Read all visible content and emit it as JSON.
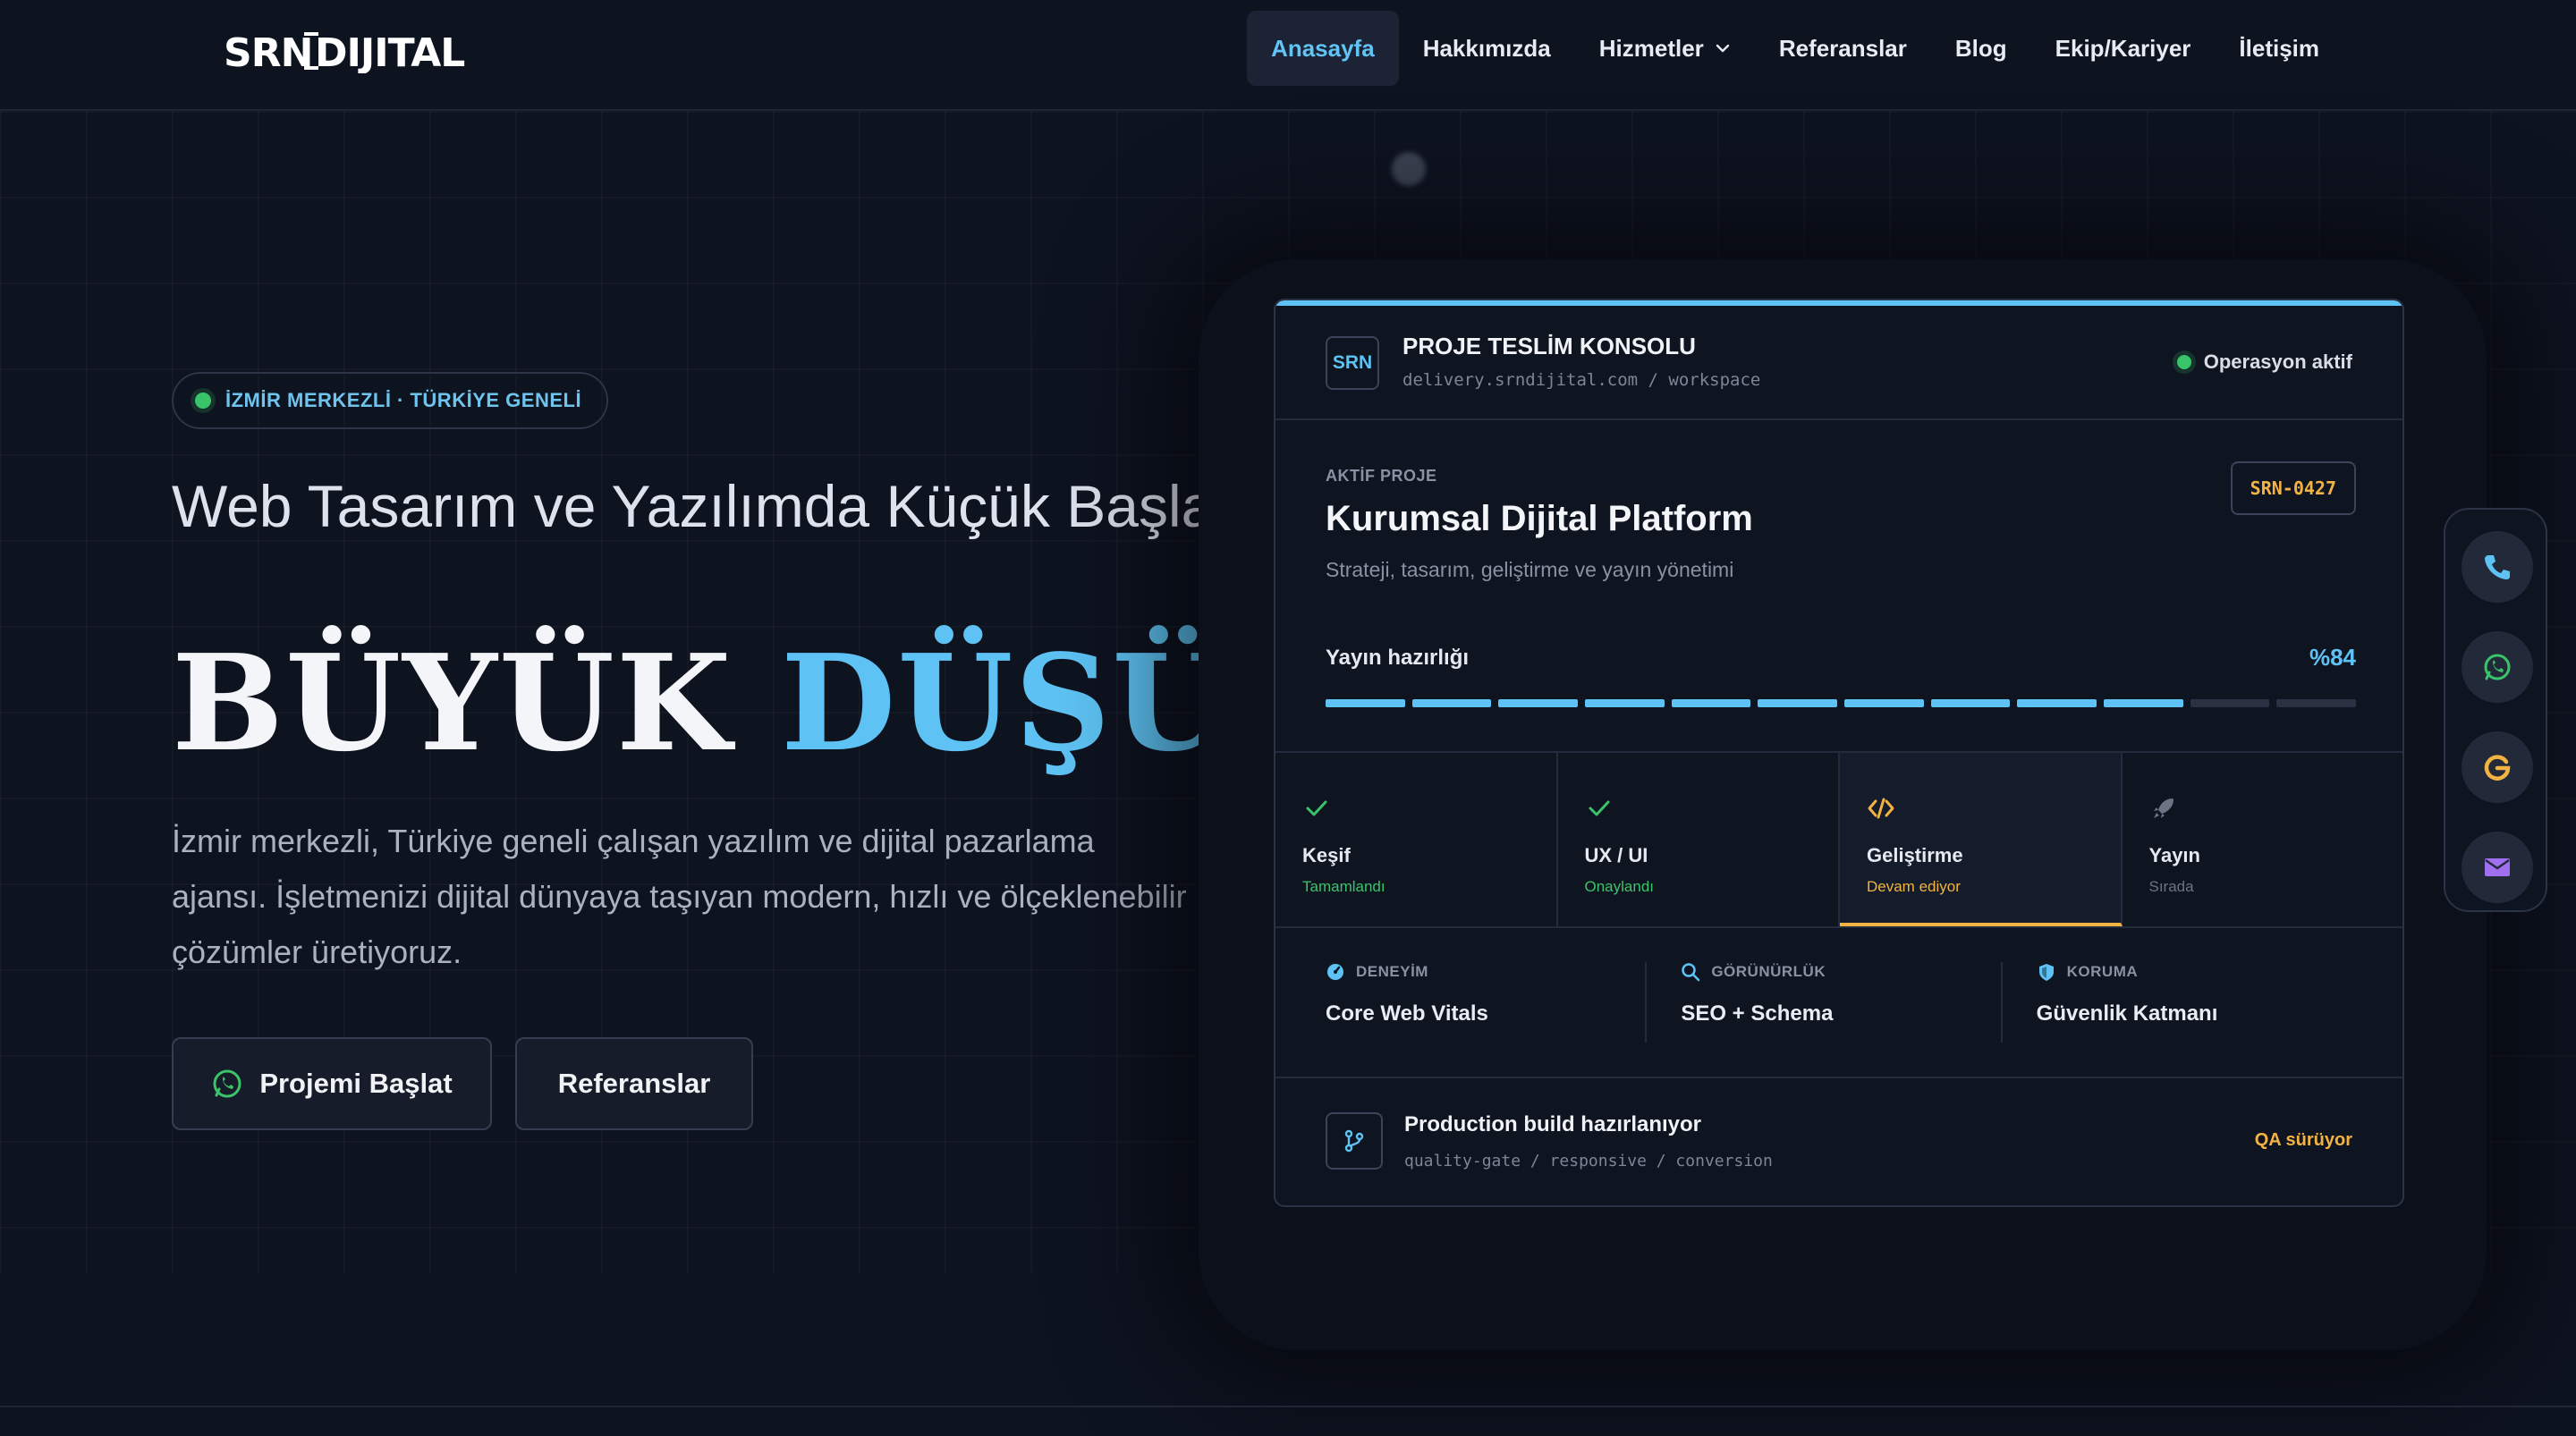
{
  "logo": {
    "text": "SRNDIJITAL"
  },
  "nav": {
    "items": [
      {
        "label": "Anasayfa",
        "active": true
      },
      {
        "label": "Hakkımızda"
      },
      {
        "label": "Hizmetler",
        "dropdown": true
      },
      {
        "label": "Referanslar"
      },
      {
        "label": "Blog"
      },
      {
        "label": "Ekip/Kariyer"
      },
      {
        "label": "İletişim"
      }
    ]
  },
  "hero": {
    "badge": "İZMİR MERKEZLİ · TÜRKİYE GENELİ",
    "headline_1": "Web Tasarım ve Yazılımda Küçük Başla,",
    "headline_2a": "BÜYÜK",
    "headline_2b": "DÜŞÜN.",
    "lead": "İzmir merkezli, Türkiye geneli çalışan yazılım ve dijital pazarlama ajansı. İşletmenizi dijital dünyaya taşıyan modern, hızlı ve ölçeklenebilir çözümler üretiyoruz.",
    "primary_button": "Projemi Başlat",
    "secondary_button": "Referanslar"
  },
  "console": {
    "badge": "SRN",
    "title": "PROJE TESLİM KONSOLU",
    "subtitle": "delivery.srndijital.com / workspace",
    "status": "Operasyon aktif",
    "project_label": "AKTİF PROJE",
    "project_title": "Kurumsal Dijital Platform",
    "project_desc": "Strateji, tasarım, geliştirme ve yayın yönetimi",
    "project_code": "SRN-0427",
    "ready_label": "Yayın hazırlığı",
    "ready_pct": "%84",
    "ready_value": 84,
    "segments_total": 12,
    "segments_done": 10,
    "steps": [
      {
        "name": "Keşif",
        "state": "Tamamlandı",
        "icon": "check-icon",
        "color": "#3ac46a"
      },
      {
        "name": "UX / UI",
        "state": "Onaylandı",
        "icon": "check-icon",
        "color": "#3ac46a"
      },
      {
        "name": "Geliştirme",
        "state": "Devam ediyor",
        "icon": "code-icon",
        "color": "#f3b342"
      },
      {
        "name": "Yayın",
        "state": "Sırada",
        "icon": "rocket-icon",
        "color": "#6b7385"
      }
    ],
    "metrics": [
      {
        "label": "DENEYİM",
        "value": "Core Web Vitals",
        "icon": "gauge-icon"
      },
      {
        "label": "GÖRÜNÜRLÜK",
        "value": "SEO + Schema",
        "icon": "search-icon"
      },
      {
        "label": "KORUMA",
        "value": "Güvenlik Katmanı",
        "icon": "shield-icon"
      }
    ],
    "footer_title": "Production build hazırlanıyor",
    "footer_sub": "quality-gate / responsive / conversion",
    "footer_status": "QA sürüyor"
  },
  "contact": [
    {
      "icon": "phone-icon",
      "color": "#5ec3f4"
    },
    {
      "icon": "whatsapp-icon",
      "color": "#3ac46a"
    },
    {
      "icon": "google-icon",
      "color": "#f3b342"
    },
    {
      "icon": "mail-icon",
      "color": "#a070f0"
    }
  ],
  "colors": {
    "accent": "#5ec3f4",
    "success": "#3ac46a",
    "warning": "#f3b342",
    "background": "#0e1320"
  }
}
